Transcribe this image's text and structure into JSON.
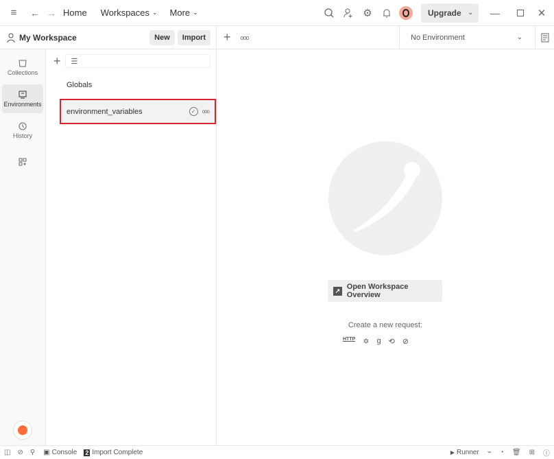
{
  "header": {
    "home": "Home",
    "workspaces": "Workspaces",
    "more": "More",
    "upgrade": "Upgrade"
  },
  "workspace": {
    "name": "My Workspace",
    "new_label": "New",
    "import_label": "Import"
  },
  "environment_select": {
    "value": "No Environment"
  },
  "rail": [
    {
      "label": "Collections"
    },
    {
      "label": "Environments"
    },
    {
      "label": "History"
    }
  ],
  "panel": {
    "items": [
      {
        "label": "Globals"
      },
      {
        "label": "environment_variables"
      }
    ]
  },
  "main": {
    "overview_button": "Open Workspace Overview",
    "create_label": "Create a new request:"
  },
  "status": {
    "console": "Console",
    "import_count": "2",
    "import_text": "Import Complete",
    "runner": "Runner"
  },
  "colors": {
    "accent": "#ff6c37",
    "highlight": "#d9232e"
  }
}
